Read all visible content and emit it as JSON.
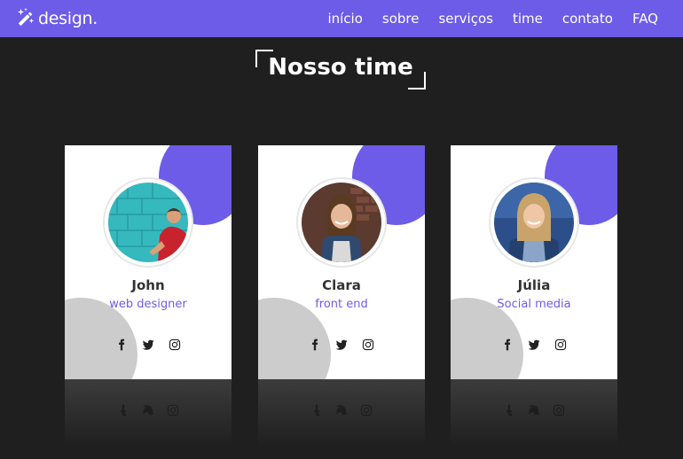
{
  "brand": {
    "name": "design.",
    "logo_icon": "magic-wand-icon"
  },
  "nav": [
    "início",
    "sobre",
    "serviços",
    "time",
    "contato",
    "FAQ"
  ],
  "section": {
    "title": "Nosso time"
  },
  "team": [
    {
      "name": "John",
      "role": "web designer"
    },
    {
      "name": "Clara",
      "role": "front end"
    },
    {
      "name": "Júlia",
      "role": "Social media"
    }
  ],
  "socials": [
    "facebook-icon",
    "twitter-icon",
    "instagram-icon"
  ],
  "colors": {
    "accent": "#6c5ce7",
    "background": "#1f1f1f",
    "card": "#ffffff",
    "blob_gray": "#cccccc"
  }
}
